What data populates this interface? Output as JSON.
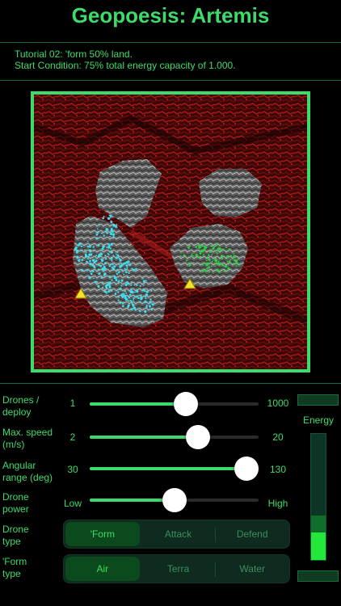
{
  "header": {
    "title": "Geopoesis: Artemis"
  },
  "tutorial": {
    "line1": "Tutorial 02: 'form 50% land.",
    "line2": "Start Condition: 75% total energy capacity of 1.000."
  },
  "map": {
    "colors": {
      "frame": "#3ddc6a",
      "terrain": "#8a1010",
      "rock": "#9a9a9a",
      "drones_a": "#3ee0f0",
      "drones_b": "#2fd04a",
      "base": "#f2e22a"
    },
    "icons": [
      "base-marker-icon",
      "base-marker-icon"
    ]
  },
  "controls": {
    "drones": {
      "label_1": "Drones /",
      "label_2": "deploy",
      "min": "1",
      "max": "1000",
      "level": 0.57
    },
    "speed": {
      "label_1": "Max. speed",
      "label_2": "(m/s)",
      "min": "2",
      "max": "20",
      "level": 0.64
    },
    "angular": {
      "label_1": "Angular",
      "label_2": "range (deg)",
      "min": "30",
      "max": "130",
      "level": 0.93
    },
    "power": {
      "label_1": "Drone",
      "label_2": "power",
      "min": "Low",
      "max": "High",
      "level": 0.5
    },
    "drone_type": {
      "label_1": "Drone",
      "label_2": "type",
      "options": [
        "'Form",
        "Attack",
        "Defend"
      ],
      "selected": "'Form"
    },
    "form_type": {
      "label_1": "'Form",
      "label_2": "type",
      "options": [
        "Air",
        "Terra",
        "Water"
      ],
      "selected": "Air"
    }
  },
  "energy": {
    "label": "Energy",
    "level": 0.22,
    "reserve_level": 0.35,
    "colors": {
      "fill": "#22e83a",
      "reserve": "#0f6f2a",
      "empty": "#0d3424"
    }
  }
}
